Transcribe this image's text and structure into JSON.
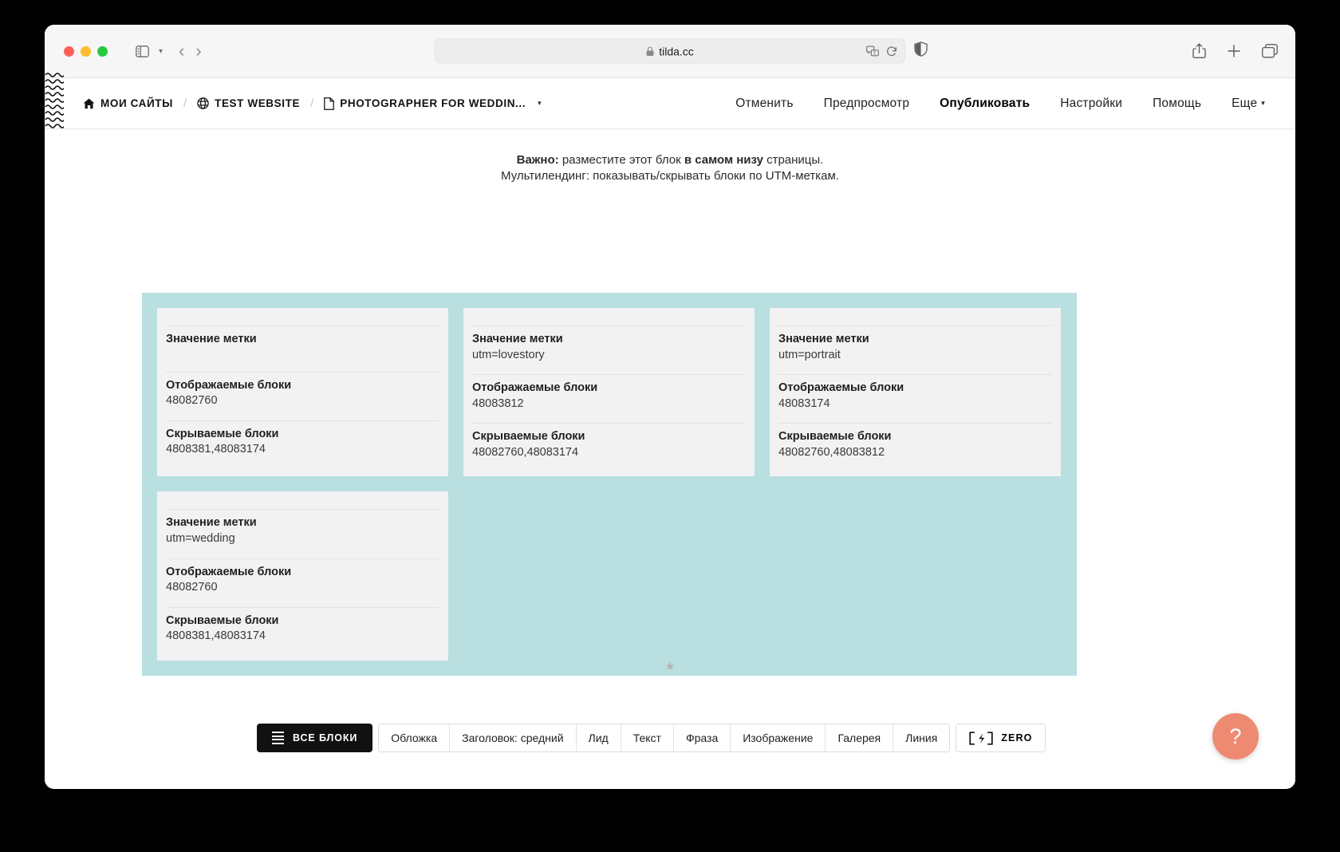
{
  "browser": {
    "url": "tilda.cc",
    "lock_icon": "lock-icon",
    "sidebar_icon": "sidebar-toggle-icon",
    "back_icon": "back-arrow-icon",
    "forward_icon": "forward-arrow-icon",
    "translate_icon": "translate-icon",
    "reload_icon": "reload-icon",
    "shield_icon": "privacy-shield-icon",
    "share_icon": "share-icon",
    "new_tab_icon": "plus-icon",
    "tabs_icon": "tab-overview-icon"
  },
  "app_header": {
    "breadcrumb": [
      {
        "icon": "home-icon",
        "label": "МОИ САЙТЫ"
      },
      {
        "icon": "globe-icon",
        "label": "TEST WEBSITE"
      },
      {
        "icon": "page-icon",
        "label": "PHOTOGRAPHER FOR WEDDIN..."
      }
    ],
    "separator": "/",
    "breadcrumb_caret": "▾",
    "nav": [
      {
        "label": "Отменить",
        "strong": false,
        "caret": ""
      },
      {
        "label": "Предпросмотр",
        "strong": false,
        "caret": ""
      },
      {
        "label": "Опубликовать",
        "strong": true,
        "caret": ""
      },
      {
        "label": "Настройки",
        "strong": false,
        "caret": ""
      },
      {
        "label": "Помощь",
        "strong": false,
        "caret": ""
      },
      {
        "label": "Еще",
        "strong": false,
        "caret": "▾"
      }
    ]
  },
  "canvas": {
    "notice": {
      "line1_bold_1": "Важно:",
      "line1_text_1": " разместите этот блок ",
      "line1_bold_2": "в самом низу",
      "line1_text_2": " страницы.",
      "line2": "Мультилендинг: показывать/скрывать блоки по UTM-меткам."
    },
    "panel_color": "#b9dfe0",
    "card_color": "#f2f2f2",
    "field_labels": {
      "tag_value": "Значение метки",
      "shown_blocks": "Отображаемые блоки",
      "hidden_blocks": "Скрываемые блоки"
    },
    "cards": [
      {
        "tag_value": "",
        "shown_blocks": "48082760",
        "hidden_blocks": "4808381,48083174"
      },
      {
        "tag_value": "utm=lovestory",
        "shown_blocks": "48083812",
        "hidden_blocks": "48082760,48083174"
      },
      {
        "tag_value": "utm=portrait",
        "shown_blocks": "48083174",
        "hidden_blocks": "48082760,48083812"
      },
      {
        "tag_value": "utm=wedding",
        "shown_blocks": "48082760",
        "hidden_blocks": "4808381,48083174"
      }
    ],
    "star_divider": "★"
  },
  "blockbar": {
    "all_blocks_label": "ВСЕ БЛОКИ",
    "all_blocks_icon": "hamburger-icon",
    "buttons": [
      "Обложка",
      "Заголовок: средний",
      "Лид",
      "Текст",
      "Фраза",
      "Изображение",
      "Галерея",
      "Линия"
    ],
    "zero_label": "ZERO",
    "zero_icon": "zero-block-icon"
  },
  "help": {
    "label": "?",
    "color": "#ef8a72"
  }
}
